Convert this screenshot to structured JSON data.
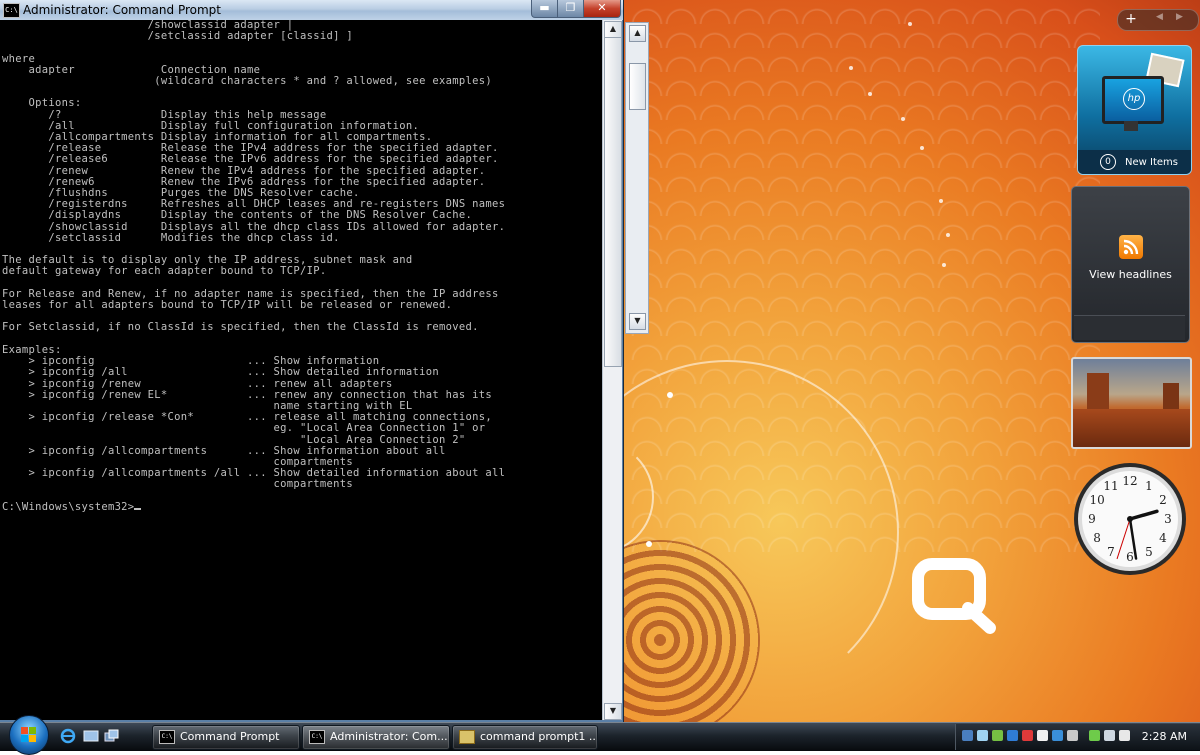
{
  "window": {
    "title": "Administrator: Command Prompt",
    "icon_text": "C:\\",
    "minimize_glyph": "▬",
    "maximize_glyph": "❐",
    "close_glyph": "✕"
  },
  "console": {
    "text": "                      /showclassid adapter |\n                      /setclassid adapter [classid] ]\n\nwhere\n    adapter             Connection name\n                       (wildcard characters * and ? allowed, see examples)\n\n    Options:\n       /?               Display this help message\n       /all             Display full configuration information.\n       /allcompartments Display information for all compartments.\n       /release         Release the IPv4 address for the specified adapter.\n       /release6        Release the IPv6 address for the specified adapter.\n       /renew           Renew the IPv4 address for the specified adapter.\n       /renew6          Renew the IPv6 address for the specified adapter.\n       /flushdns        Purges the DNS Resolver cache.\n       /registerdns     Refreshes all DHCP leases and re-registers DNS names\n       /displaydns      Display the contents of the DNS Resolver Cache.\n       /showclassid     Displays all the dhcp class IDs allowed for adapter.\n       /setclassid      Modifies the dhcp class id.\n\nThe default is to display only the IP address, subnet mask and\ndefault gateway for each adapter bound to TCP/IP.\n\nFor Release and Renew, if no adapter name is specified, then the IP address\nleases for all adapters bound to TCP/IP will be released or renewed.\n\nFor Setclassid, if no ClassId is specified, then the ClassId is removed.\n\nExamples:\n    > ipconfig                       ... Show information\n    > ipconfig /all                  ... Show detailed information\n    > ipconfig /renew                ... renew all adapters\n    > ipconfig /renew EL*            ... renew any connection that has its\n                                         name starting with EL\n    > ipconfig /release *Con*        ... release all matching connections,\n                                         eg. \"Local Area Connection 1\" or\n                                             \"Local Area Connection 2\"\n    > ipconfig /allcompartments      ... Show information about all\n                                         compartments\n    > ipconfig /allcompartments /all ... Show detailed information about all\n                                         compartments\n\n",
    "prompt": "C:\\Windows\\system32>"
  },
  "scrollbar": {
    "up": "▲",
    "down": "▼"
  },
  "sidebar": {
    "add_glyph": "+",
    "prev_glyph": "◀",
    "next_glyph": "▶",
    "hp_gadget": {
      "logo": "hp",
      "count": "0",
      "label": "New Items"
    },
    "feed_gadget": {
      "label": "View headlines"
    },
    "clock_gadget": {
      "numerals": [
        "12",
        "1",
        "2",
        "3",
        "4",
        "5",
        "6",
        "7",
        "8",
        "9",
        "10",
        "11"
      ],
      "hour": 2,
      "minute": 28,
      "second": 33
    }
  },
  "taskbar": {
    "tasks": [
      {
        "label": "Command Prompt",
        "icon": "cmd-icon"
      },
      {
        "label": "Administrator: Com...",
        "icon": "cmd-icon"
      },
      {
        "label": "command prompt1 ...",
        "icon": "firefox-icon"
      }
    ],
    "clock": "2:28 AM"
  },
  "colors": {
    "console_bg": "#000000",
    "console_fg": "#c0c0c0",
    "taskbar": "#1c232b",
    "accent": "#ea7a22"
  }
}
